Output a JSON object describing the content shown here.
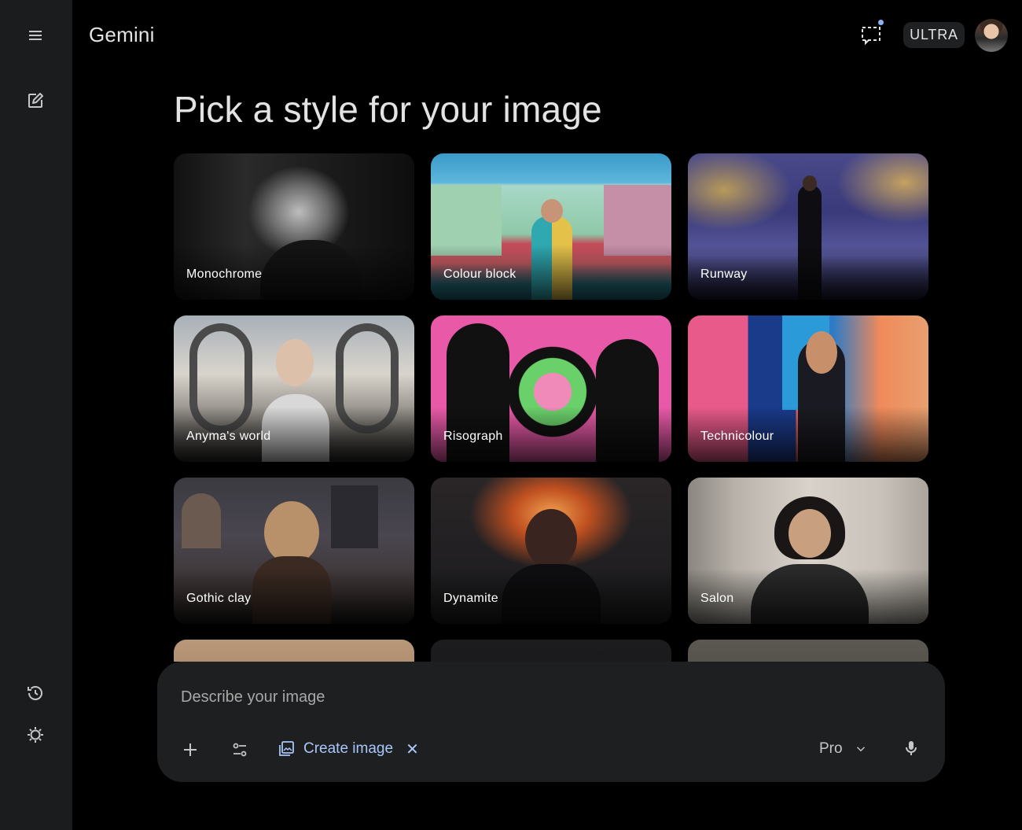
{
  "app": {
    "title": "Gemini",
    "plan_badge": "ULTRA"
  },
  "sidebar": {
    "items": [
      "menu-icon",
      "new-chat-icon",
      "history-icon",
      "settings-icon"
    ]
  },
  "main": {
    "heading": "Pick a style for your image",
    "styles": [
      {
        "label": "Monochrome"
      },
      {
        "label": "Colour block"
      },
      {
        "label": "Runway"
      },
      {
        "label": "Anyma's world"
      },
      {
        "label": "Risograph"
      },
      {
        "label": "Technicolour"
      },
      {
        "label": "Gothic clay"
      },
      {
        "label": "Dynamite"
      },
      {
        "label": "Salon"
      }
    ]
  },
  "composer": {
    "placeholder": "Describe your image",
    "tool_chip": "Create image",
    "model": "Pro"
  },
  "colors": {
    "accent": "#a8c7fa",
    "sidebar_bg": "#1b1c1d",
    "composer_bg": "#1e1f20"
  }
}
